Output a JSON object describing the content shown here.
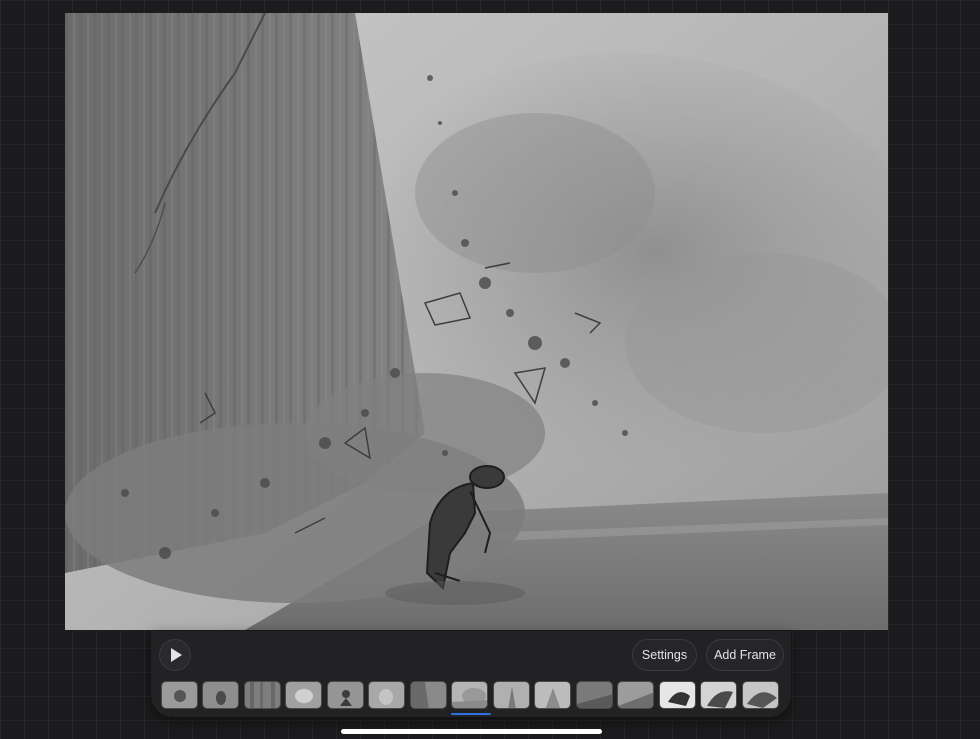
{
  "artwork": {
    "name": "falling-cliff-painting",
    "palette": "grayscale"
  },
  "animation_bar": {
    "play_icon": "play-icon",
    "settings_label": "Settings",
    "add_frame_label": "Add Frame",
    "frame_count": 15,
    "selected_frame_index": 8,
    "accent_color": "#2f6fe0"
  },
  "colors": {
    "background": "#1c1c1e",
    "panel": "#222224",
    "text": "#e4e4e6"
  }
}
